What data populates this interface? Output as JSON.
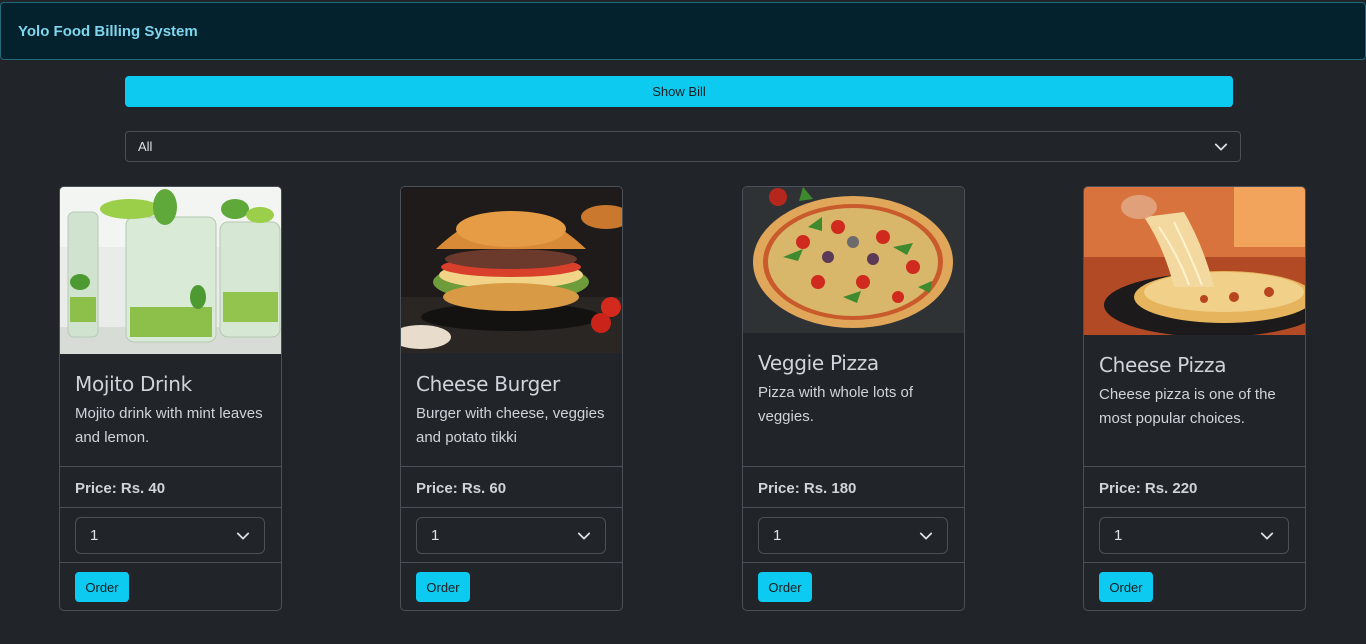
{
  "app": {
    "brand": "Yolo Food Billing System"
  },
  "actions": {
    "show_bill": "Show Bill"
  },
  "filter": {
    "selected": "All"
  },
  "colors": {
    "accent": "#0dcaf0",
    "navbar_bg": "#03222d",
    "page_bg": "#212529",
    "brand_text": "#7fd6ee"
  },
  "products": [
    {
      "name": "Mojito Drink",
      "description": "Mojito drink with mint leaves and lemon.",
      "price": "Price: Rs. 40",
      "quantity": "1",
      "order_label": "Order",
      "image": "mojito-drink-photo"
    },
    {
      "name": "Cheese Burger",
      "description": "Burger with cheese, veggies and potato tikki",
      "price": "Price: Rs. 60",
      "quantity": "1",
      "order_label": "Order",
      "image": "cheese-burger-photo"
    },
    {
      "name": "Veggie Pizza",
      "description": "Pizza with whole lots of veggies.",
      "price": "Price: Rs. 180",
      "quantity": "1",
      "order_label": "Order",
      "image": "veggie-pizza-photo"
    },
    {
      "name": "Cheese Pizza",
      "description": "Cheese pizza is one of the most popular choices.",
      "price": "Price: Rs. 220",
      "quantity": "1",
      "order_label": "Order",
      "image": "cheese-pizza-photo"
    }
  ]
}
